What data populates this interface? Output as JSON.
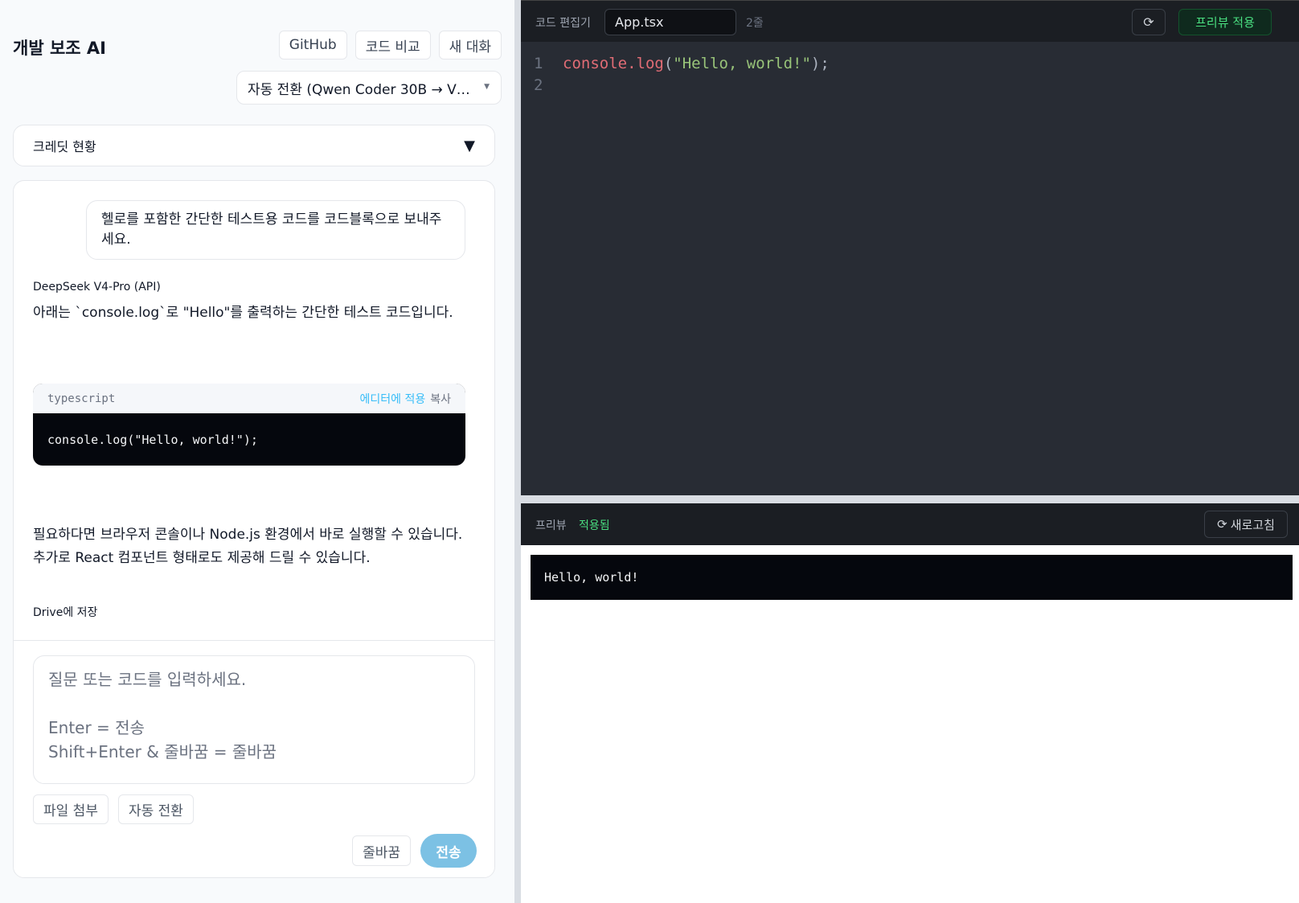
{
  "header": {
    "title": "개발 보조 AI",
    "buttons": {
      "github": "GitHub",
      "compare": "코드 비교",
      "new_chat": "새 대화"
    },
    "model_select": "자동 전환 (Qwen Coder 30B → V…"
  },
  "credit": {
    "label": "크레딧 현황",
    "toggle_icon": "triangle-down-icon"
  },
  "chat": {
    "user_message": "헬로를 포함한 간단한 테스트용 코드를 코드블록으로 보내주세요.",
    "assistant": {
      "model": "DeepSeek V4-Pro (API)",
      "intro": "아래는 `console.log`로 \"Hello\"를 출력하는 간단한 테스트 코드입니다.",
      "code_block": {
        "language": "typescript",
        "apply_label": "에디터에 적용",
        "copy_label": "복사",
        "code": "console.log(\"Hello, world!\");"
      },
      "outro_1": "필요하다면 브라우저 콘솔이나 Node.js 환경에서 바로 실행할 수 있습니다.",
      "outro_2": "추가로 React 컴포넌트 형태로도 제공해 드릴 수 있습니다.",
      "drive_save": "Drive에 저장"
    }
  },
  "composer": {
    "placeholder": "질문 또는 코드를 입력하세요.\n\nEnter = 전송\nShift+Enter & 줄바꿈 = 줄바꿈",
    "attach_label": "파일 첨부",
    "auto_switch_label": "자동 전환",
    "newline_label": "줄바꿈",
    "send_label": "전송"
  },
  "editor": {
    "label": "코드 편집기",
    "filename": "App.tsx",
    "line_count": "2줄",
    "reload_icon": "reload-icon",
    "apply_preview_label": "프리뷰 적용",
    "lines": [
      {
        "num": "1",
        "fn": "console.log",
        "open": "(",
        "str": "\"Hello, world!\"",
        "close": ");"
      },
      {
        "num": "2"
      }
    ]
  },
  "preview": {
    "label": "프리뷰",
    "status": "적용됨",
    "refresh_label": "새로고침",
    "output": "Hello, world!"
  },
  "colors": {
    "accent_send": "#7cc1e4",
    "apply_link": "#38bdf8",
    "status_green": "#4ade80",
    "editor_bg": "#282c34"
  }
}
